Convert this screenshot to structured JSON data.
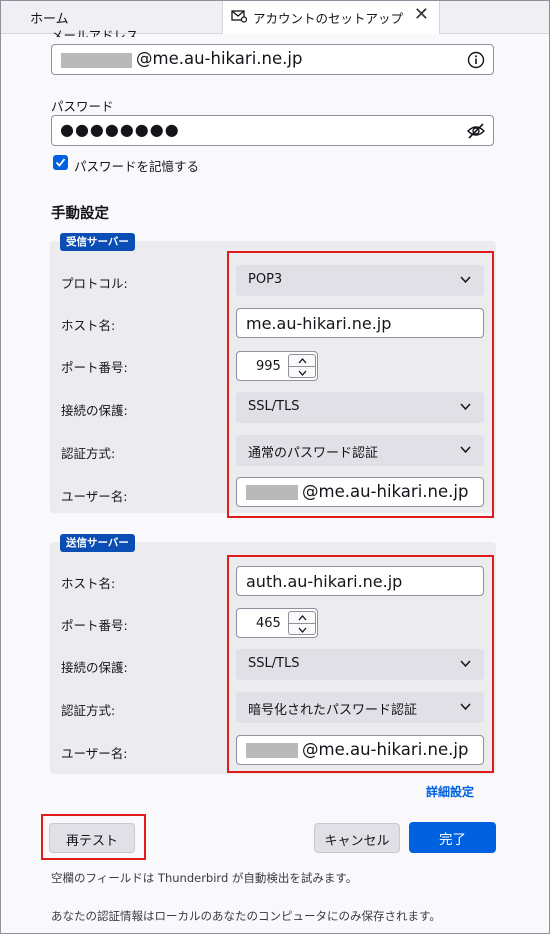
{
  "tabs": {
    "home": "ホーム",
    "active": "アカウントのセットアップ",
    "close": "✕"
  },
  "email": {
    "label": "メールアドレス",
    "domain": "@me.au-hikari.ne.jp"
  },
  "password": {
    "label": "パスワード",
    "masked": "●●●●●●●●",
    "remember_label": "パスワードを記憶する",
    "remember_checked": true
  },
  "manual": {
    "title": "手動設定",
    "incoming": {
      "badge": "受信サーバー",
      "protocol_label": "プロトコル:",
      "protocol": "POP3",
      "host_label": "ホスト名:",
      "host": "me.au-hikari.ne.jp",
      "port_label": "ポート番号:",
      "port": "995",
      "security_label": "接続の保護:",
      "security": "SSL/TLS",
      "auth_label": "認証方式:",
      "auth": "通常のパスワード認証",
      "user_label": "ユーザー名:",
      "user_domain": "@me.au-hikari.ne.jp"
    },
    "outgoing": {
      "badge": "送信サーバー",
      "host_label": "ホスト名:",
      "host": "auth.au-hikari.ne.jp",
      "port_label": "ポート番号:",
      "port": "465",
      "security_label": "接続の保護:",
      "security": "SSL/TLS",
      "auth_label": "認証方式:",
      "auth": "暗号化されたパスワード認証",
      "user_label": "ユーザー名:",
      "user_domain": "@me.au-hikari.ne.jp"
    },
    "advanced_link": "詳細設定"
  },
  "buttons": {
    "retest": "再テスト",
    "cancel": "キャンセル",
    "done": "完了"
  },
  "notes": {
    "autodetect": "空欄のフィールドは Thunderbird が自動検出を試みます。",
    "local_storage": "あなたの認証情報はローカルのあなたのコンピュータにのみ保存されます。"
  },
  "colors": {
    "accent": "#0061e0",
    "badge": "#0a4db4",
    "highlight": "#e01c1c"
  }
}
